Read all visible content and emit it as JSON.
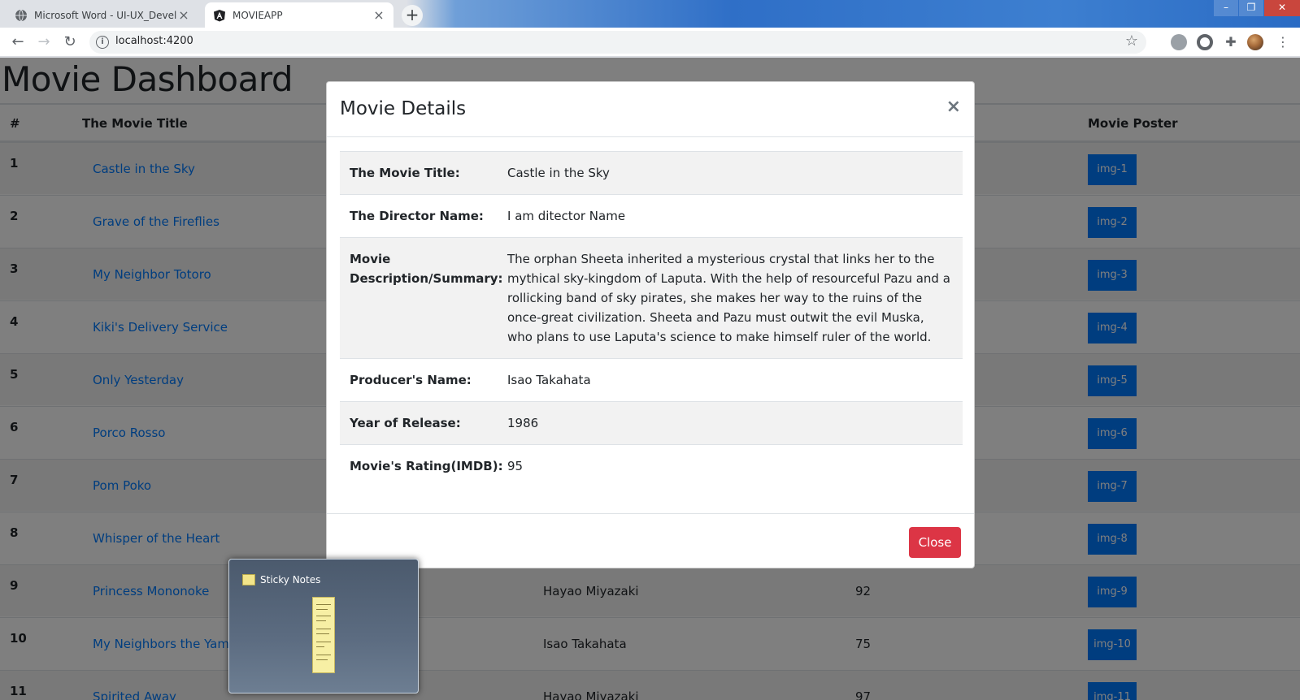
{
  "browser": {
    "tabs": [
      {
        "title": "Microsoft Word - UI-UX_Develop",
        "active": false
      },
      {
        "title": "MOVIEAPP",
        "active": true
      }
    ],
    "url": "localhost:4200"
  },
  "page": {
    "title": "Movie Dashboard",
    "columns": {
      "num": "#",
      "title": "The Movie Title",
      "poster": "Movie Poster"
    },
    "rows": [
      {
        "num": "1",
        "title": "Castle in the Sky",
        "director": "",
        "rating": "",
        "poster": "img-1"
      },
      {
        "num": "2",
        "title": "Grave of the Fireflies",
        "director": "",
        "rating": "",
        "poster": "img-2"
      },
      {
        "num": "3",
        "title": "My Neighbor Totoro",
        "director": "",
        "rating": "",
        "poster": "img-3"
      },
      {
        "num": "4",
        "title": "Kiki's Delivery Service",
        "director": "",
        "rating": "",
        "poster": "img-4"
      },
      {
        "num": "5",
        "title": "Only Yesterday",
        "director": "",
        "rating": "",
        "poster": "img-5"
      },
      {
        "num": "6",
        "title": "Porco Rosso",
        "director": "",
        "rating": "",
        "poster": "img-6"
      },
      {
        "num": "7",
        "title": "Pom Poko",
        "director": "",
        "rating": "",
        "poster": "img-7"
      },
      {
        "num": "8",
        "title": "Whisper of the Heart",
        "director": "",
        "rating": "",
        "poster": "img-8"
      },
      {
        "num": "9",
        "title": "Princess Mononoke",
        "director": "Hayao Miyazaki",
        "rating": "92",
        "poster": "img-9"
      },
      {
        "num": "10",
        "title": "My Neighbors the Yamadas",
        "director": "Isao Takahata",
        "rating": "75",
        "poster": "img-10"
      },
      {
        "num": "11",
        "title": "Spirited Away",
        "director": "Hayao Miyazaki",
        "rating": "97",
        "poster": "img-11"
      }
    ]
  },
  "modal": {
    "title": "Movie Details",
    "close_x": "×",
    "details": [
      {
        "label": "The Movie Title:",
        "value": "Castle in the Sky"
      },
      {
        "label": "The Director Name:",
        "value": "I am ditector Name"
      },
      {
        "label": "Movie Description/Summary:",
        "value": "The orphan Sheeta inherited a mysterious crystal that links her to the mythical sky-kingdom of Laputa. With the help of resourceful Pazu and a rollicking band of sky pirates, she makes her way to the ruins of the once-great civilization. Sheeta and Pazu must outwit the evil Muska, who plans to use Laputa's science to make himself ruler of the world."
      },
      {
        "label": "Producer's Name:",
        "value": "Isao Takahata"
      },
      {
        "label": "Year of Release:",
        "value": "1986"
      },
      {
        "label": "Movie's Rating(IMDB):",
        "value": "95"
      }
    ],
    "close_button": "Close"
  },
  "taskbar_preview": {
    "app_name": "Sticky Notes"
  },
  "colors": {
    "link": "#007bff",
    "poster_bg": "#007bff",
    "close_button": "#dc3545",
    "overlay": "rgba(0,0,0,0.5)"
  }
}
